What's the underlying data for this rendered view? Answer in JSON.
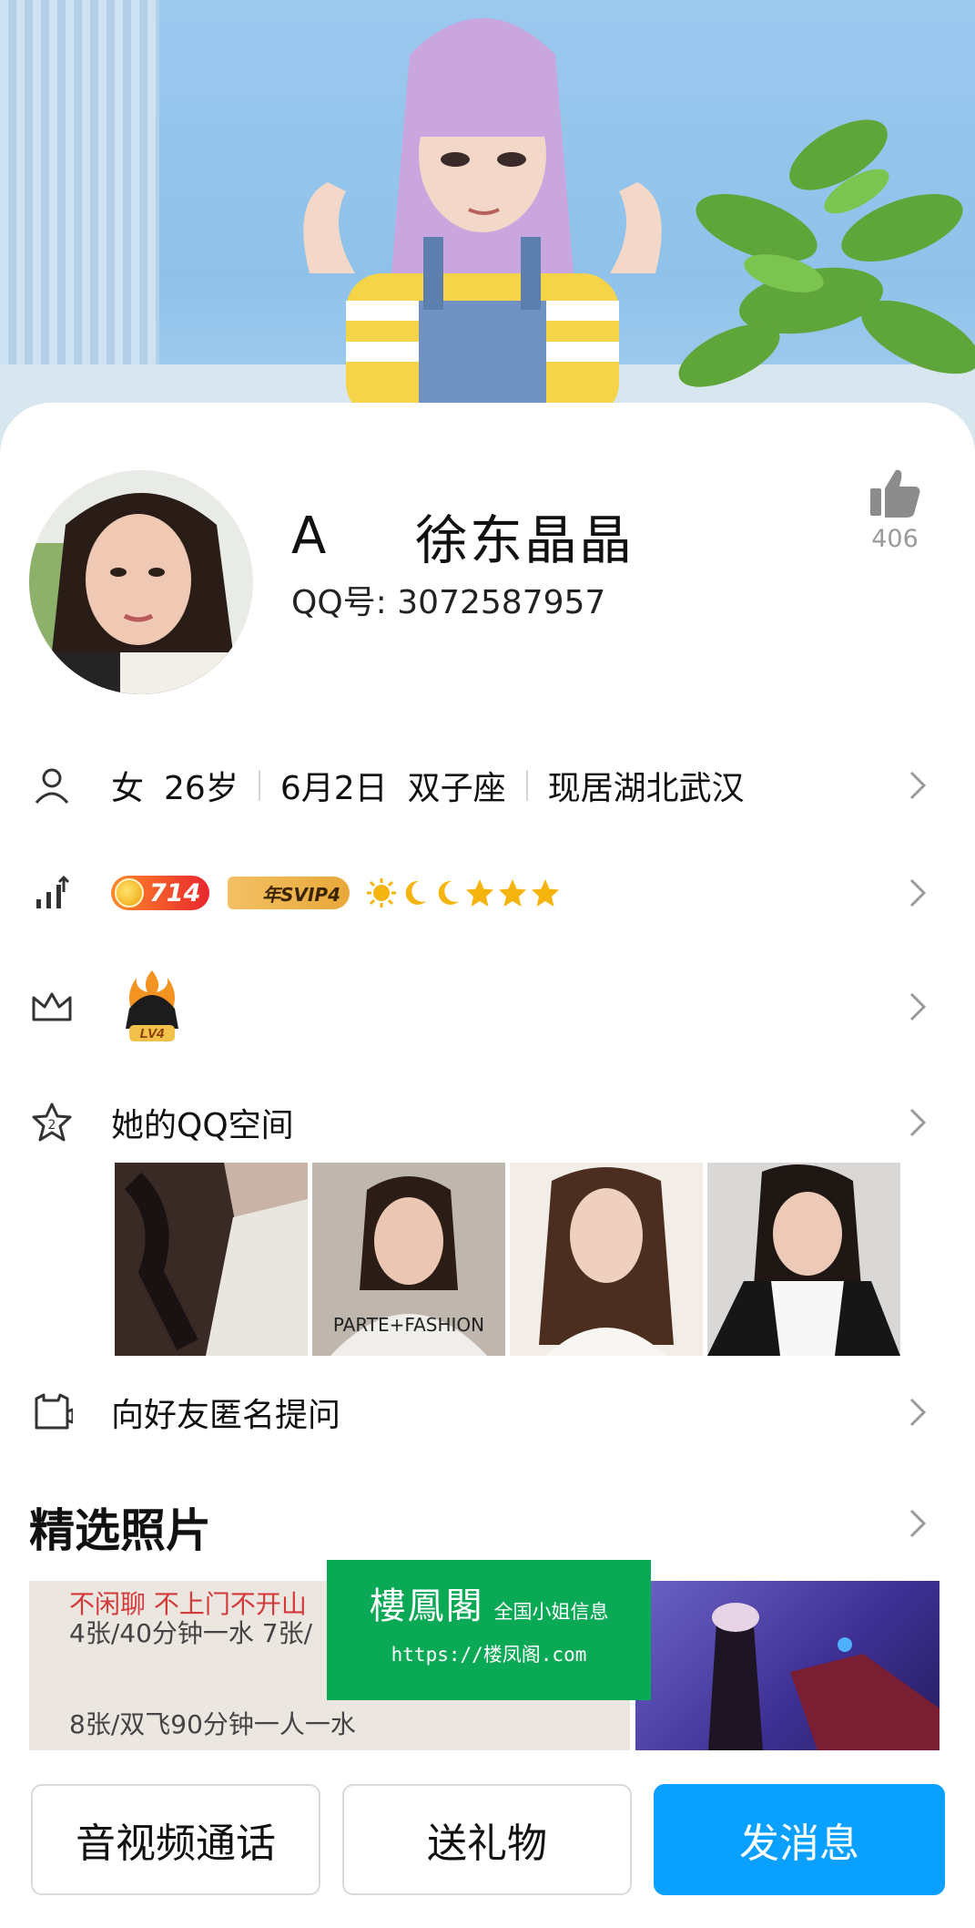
{
  "profile": {
    "nick_prefix": "A",
    "nick_name": "徐东晶晶",
    "qq_label": "QQ号:",
    "qq_number": "3072587957",
    "likes": "406"
  },
  "info_row": {
    "gender": "女",
    "age": "26岁",
    "birthday": "6月2日",
    "zodiac": "双子座",
    "location": "现居湖北武汉"
  },
  "level_row": {
    "level_number": "714",
    "svip_label": "年SVIP4"
  },
  "vip_row": {
    "badge_label": "LV4"
  },
  "qzone": {
    "label": "她的QQ空间",
    "thumbnail_count": 4
  },
  "anon_question": {
    "label": "向好友匿名提问"
  },
  "featured": {
    "title": "精选照片",
    "photo_text_line1": "不闲聊 不上门不开山",
    "photo_text_line2": "4张/40分钟一水   7张/",
    "photo_text_line3": "8张/双飞90分钟一人一水"
  },
  "watermark": {
    "title": "樓鳳閣",
    "subtitle": "全国小姐信息",
    "url": "https://楼凤阁.com"
  },
  "actions": {
    "call": "音视频通话",
    "gift": "送礼物",
    "message": "发消息"
  },
  "colors": {
    "primary_button": "#0aa0ff",
    "watermark_bg": "#0aa956",
    "level_badge": "#e8262c"
  }
}
